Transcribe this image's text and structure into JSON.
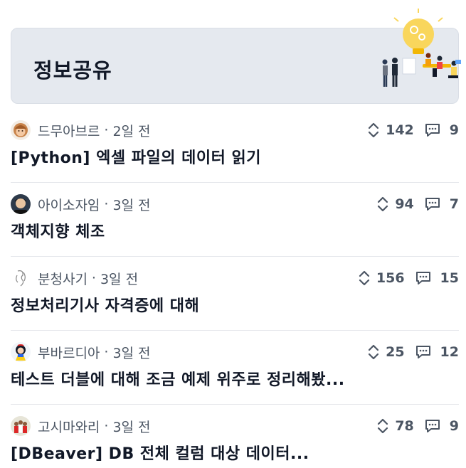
{
  "header": {
    "title": "정보공유",
    "illustration_icon": "team-lightbulb-illustration"
  },
  "posts": [
    {
      "author": "드무아브르",
      "separator": "·",
      "time": "2일 전",
      "votes": "142",
      "comments": "9",
      "title": "[Python] 엑셀 파일의 데이터 읽기",
      "avatar_icon": "avatar-cartoon-face-icon"
    },
    {
      "author": "아이소자임",
      "separator": "·",
      "time": "3일 전",
      "votes": "94",
      "comments": "7",
      "title": "객체지향 체조",
      "avatar_icon": "avatar-person-icon"
    },
    {
      "author": "분청사기",
      "separator": "·",
      "time": "3일 전",
      "votes": "156",
      "comments": "15",
      "title": "정보처리기사 자격증에 대해",
      "avatar_icon": "avatar-sketch-icon"
    },
    {
      "author": "부바르디아",
      "separator": "·",
      "time": "3일 전",
      "votes": "25",
      "comments": "12",
      "title": "테스트 더블에 대해 조금 예제 위주로 정리해봤...",
      "avatar_icon": "avatar-snowwhite-icon"
    },
    {
      "author": "고시마와리",
      "separator": "·",
      "time": "3일 전",
      "votes": "78",
      "comments": "9",
      "title": "[DBeaver] DB 전체 컬럼 대상 데이터...",
      "avatar_icon": "avatar-group-icon"
    }
  ],
  "colors": {
    "banner_bg": "#e5e9ef",
    "text_primary": "#111827",
    "text_secondary": "#4b5563",
    "divider": "#e5e7eb"
  }
}
